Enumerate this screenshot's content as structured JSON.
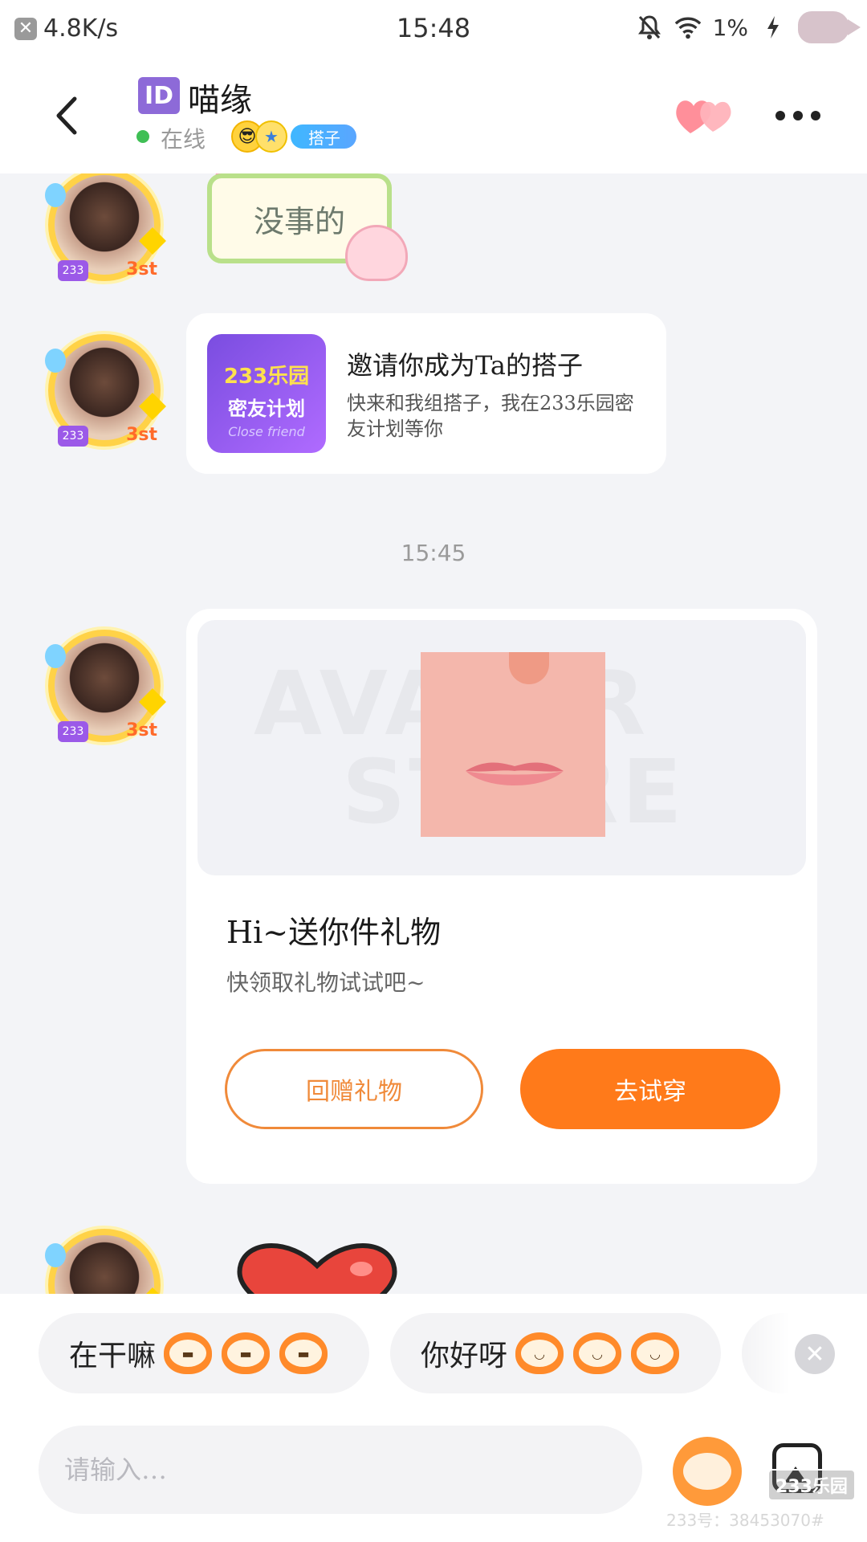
{
  "status_bar": {
    "net_speed": "4.8K/s",
    "time": "15:48",
    "battery": "1%"
  },
  "header": {
    "id_badge": "ID",
    "name": "喵缘",
    "status": "在线",
    "partner_label": "搭子"
  },
  "messages": {
    "sticker_text": "没事的",
    "invite": {
      "icon_line1": "233乐园",
      "icon_line2": "密友计划",
      "icon_line3": "Close friend",
      "title": "邀请你成为Ta的搭子",
      "description": "快来和我组搭子，我在233乐园密友计划等你"
    },
    "time_separator": "15:45",
    "gift": {
      "watermark_1": "AVATAR",
      "watermark_2": "STORE",
      "title": "Hi~送你件礼物",
      "subtitle": "快领取礼物试试吧~",
      "return_button": "回赠礼物",
      "try_button": "去试穿"
    },
    "avatar_tag": "3st",
    "avatar_badge": "233"
  },
  "quick_replies": [
    {
      "label": "在干嘛"
    },
    {
      "label": "你好呀"
    }
  ],
  "input": {
    "placeholder": "请输入…"
  },
  "watermark": {
    "logo": "233乐园",
    "user_id": "233号：38453070#"
  },
  "colors": {
    "accent_orange": "#ff7a1a",
    "id_purple": "#8d6ad8",
    "online_green": "#3fbf55",
    "background": "#f3f4f7"
  }
}
